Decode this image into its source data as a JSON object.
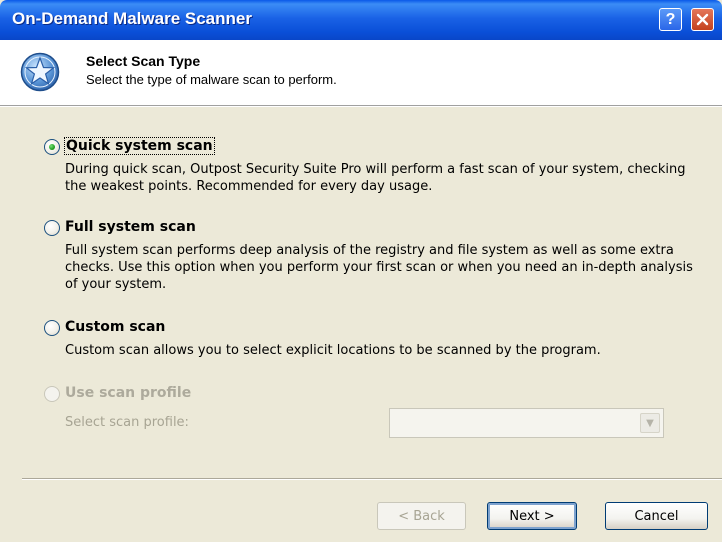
{
  "window": {
    "title": "On-Demand Malware Scanner",
    "help_glyph": "?",
    "close_icon": "close-icon"
  },
  "header": {
    "icon": "star-icon",
    "title": "Select Scan Type",
    "subtitle": "Select the type of malware scan to perform."
  },
  "options": [
    {
      "label": "Quick system scan",
      "selected": true,
      "enabled": true,
      "description": "During quick scan, Outpost Security Suite Pro will perform a fast scan of your system, checking the weakest points. Recommended for every day usage."
    },
    {
      "label": "Full system scan",
      "selected": false,
      "enabled": true,
      "description": "Full system scan performs deep analysis of the registry and file system as well as some extra checks. Use this option when you perform your first scan or when you need an in-depth analysis of your system."
    },
    {
      "label": "Custom scan",
      "selected": false,
      "enabled": true,
      "description": "Custom scan allows you to select explicit locations to be scanned by the program."
    },
    {
      "label": "Use scan profile",
      "selected": false,
      "enabled": false,
      "description": ""
    }
  ],
  "profile": {
    "label": "Select scan profile:",
    "value": ""
  },
  "buttons": {
    "back": "< Back",
    "next": "Next >",
    "cancel": "Cancel"
  },
  "colors": {
    "titlebar": "#0a58e8",
    "dialog_bg": "#ece9d8",
    "radio_selected": "#21a121"
  }
}
